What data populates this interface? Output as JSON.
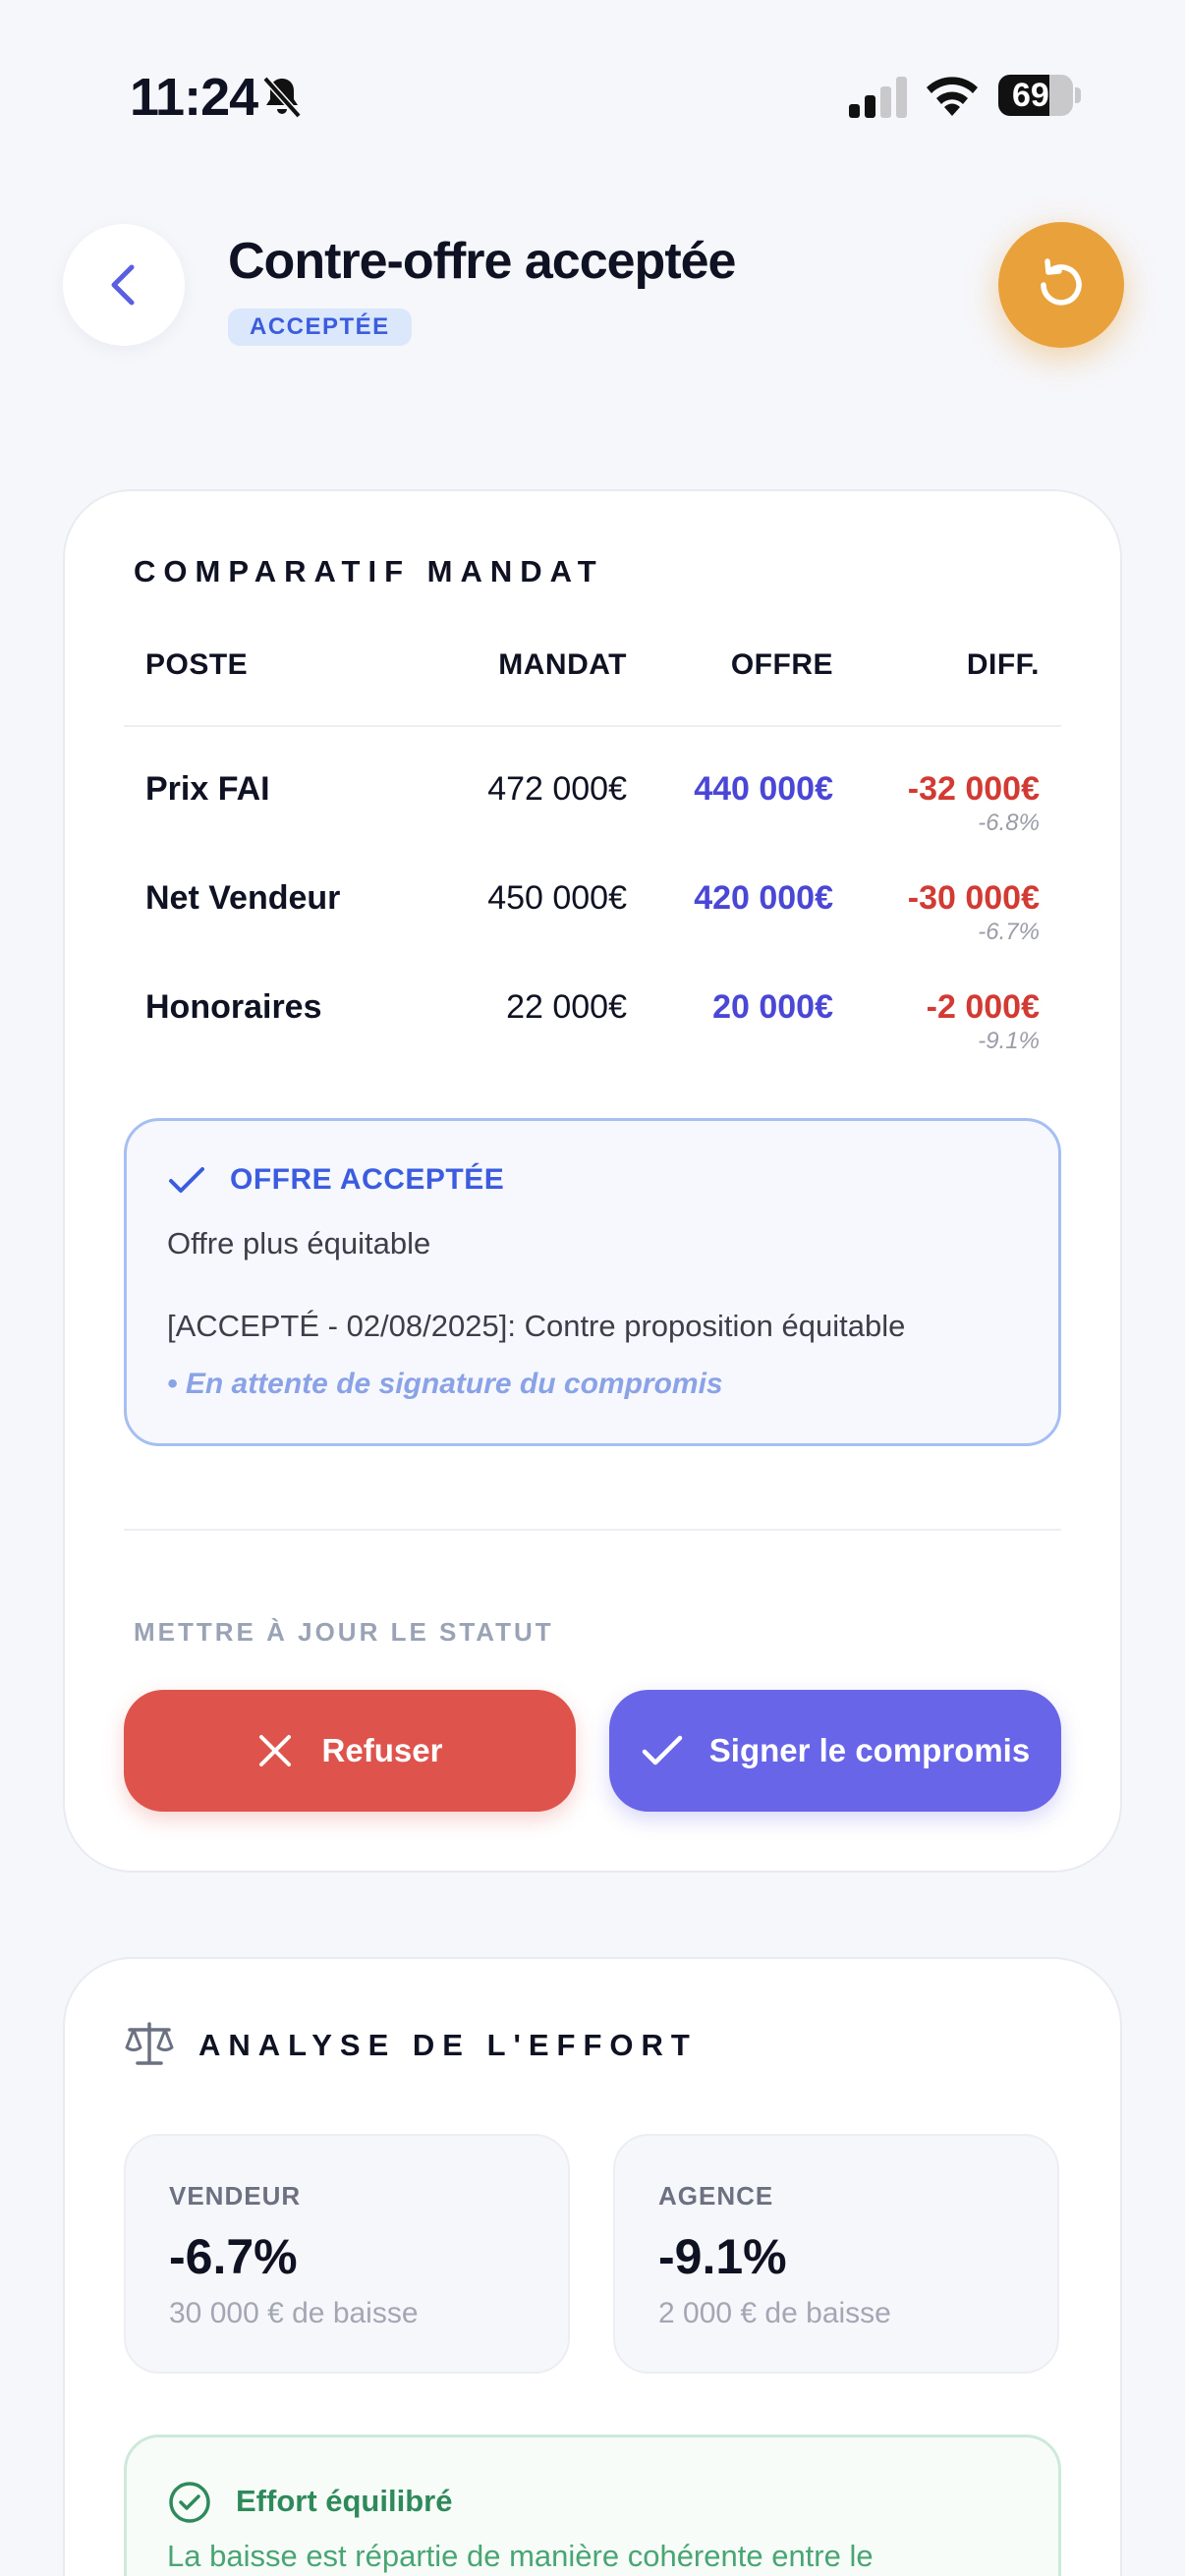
{
  "status_bar": {
    "time": "11:24",
    "battery": "69",
    "battery_level": 0.69
  },
  "header": {
    "title": "Contre-offre acceptée",
    "status_badge": "ACCEPTÉE"
  },
  "comparatif": {
    "title": "COMPARATIF MANDAT",
    "columns": {
      "poste": "POSTE",
      "mandat": "MANDAT",
      "offre": "OFFRE",
      "diff": "DIFF."
    },
    "rows": [
      {
        "poste": "Prix FAI",
        "mandat": "472 000€",
        "offre": "440 000€",
        "diff": "-32 000€",
        "pct": "-6.8%"
      },
      {
        "poste": "Net Vendeur",
        "mandat": "450 000€",
        "offre": "420 000€",
        "diff": "-30 000€",
        "pct": "-6.7%"
      },
      {
        "poste": "Honoraires",
        "mandat": "22 000€",
        "offre": "20 000€",
        "diff": "-2 000€",
        "pct": "-9.1%"
      }
    ]
  },
  "acceptance": {
    "title": "OFFRE ACCEPTÉE",
    "line1": "Offre plus équitable",
    "line2": "[ACCEPTÉ - 02/08/2025]: Contre proposition équitable",
    "line3": "• En attente de signature du compromis"
  },
  "status_update": {
    "label": "METTRE À JOUR LE STATUT",
    "refuse_label": "Refuser",
    "sign_label": "Signer le compromis"
  },
  "effort": {
    "title": "ANALYSE DE L'EFFORT",
    "vendeur": {
      "label": "VENDEUR",
      "value": "-6.7%",
      "sub": "30 000 € de baisse"
    },
    "agence": {
      "label": "AGENCE",
      "value": "-9.1%",
      "sub": "2 000 € de baisse"
    },
    "verdict_title": "Effort équilibré",
    "verdict_desc": "La baisse est répartie de manière cohérente entre le"
  },
  "colors": {
    "accent": "#6865e9",
    "refuse": "#de534b",
    "reset": "#e9a23b",
    "offer": "#4a47d6",
    "diff": "#d23b33",
    "success": "#2f8a5b"
  },
  "icons": {
    "back": "chevron-left-icon",
    "reset": "rotate-ccw-icon",
    "bell": "bell-slash-icon",
    "check": "check-icon",
    "close": "x-icon",
    "scale": "scale-icon",
    "circle_check": "check-circle-icon"
  }
}
